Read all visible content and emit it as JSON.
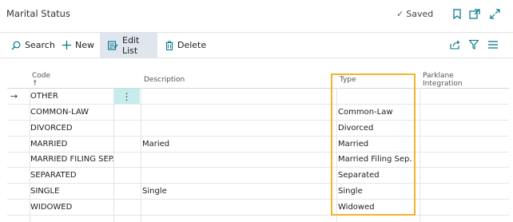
{
  "header": {
    "title": "Marital Status",
    "saved_label": "Saved"
  },
  "toolbar": {
    "search_label": "Search",
    "new_label": "New",
    "edit_list_label": "Edit List",
    "delete_label": "Delete"
  },
  "table": {
    "columns": [
      "Code ↑",
      "Description",
      "Type",
      "Parklane Integration"
    ],
    "rows": [
      {
        "code": "OTHER",
        "description": "",
        "type": "",
        "integration": ""
      },
      {
        "code": "COMMON-LAW",
        "description": "",
        "type": "Common-Law",
        "integration": ""
      },
      {
        "code": "DIVORCED",
        "description": "",
        "type": "Divorced",
        "integration": ""
      },
      {
        "code": "MARRIED",
        "description": "Maried",
        "type": "Married",
        "integration": ""
      },
      {
        "code": "MARRIED FILING SEP.",
        "description": "",
        "type": "Married Filing Sep.",
        "integration": ""
      },
      {
        "code": "SEPARATED",
        "description": "",
        "type": "Separated",
        "integration": ""
      },
      {
        "code": "SINGLE",
        "description": "Single",
        "type": "Single",
        "integration": ""
      },
      {
        "code": "WIDOWED",
        "description": "",
        "type": "Widowed",
        "integration": ""
      }
    ]
  },
  "colors": {
    "accent": "#00758a",
    "highlight_box": "#f0b52d",
    "selected_cell": "#c7ecee"
  }
}
